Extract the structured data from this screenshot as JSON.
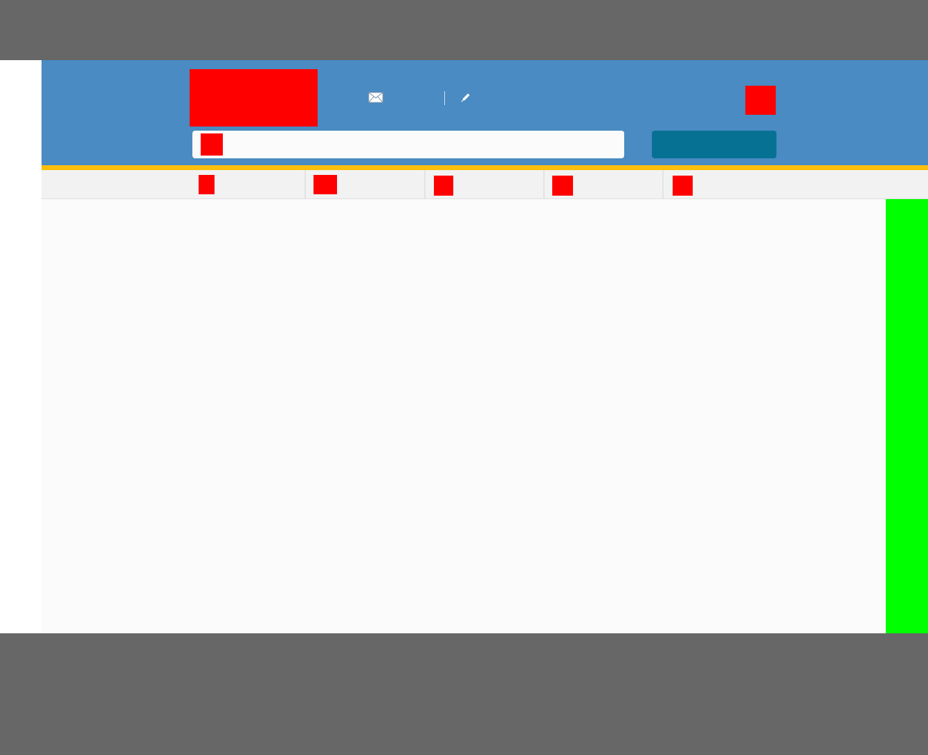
{
  "colors": {
    "backdrop": "#676767",
    "page_background": "#ffffff",
    "header_background": "#498bc2",
    "accent_stripe": "#fbbf0b",
    "nav_background": "#f2f2f2",
    "content_background": "#fbfbfb",
    "search_button": "#077194",
    "side_rail": "#00ff00",
    "placeholder": "#ff0000"
  },
  "header": {
    "logo": "",
    "links": [
      {
        "icon": "envelope-icon",
        "label": ""
      },
      {
        "icon": "pencil-icon",
        "label": ""
      }
    ],
    "cart_label": ""
  },
  "search": {
    "value": "",
    "placeholder": "",
    "button_label": ""
  },
  "nav": {
    "items": [
      {
        "label": ""
      },
      {
        "label": ""
      },
      {
        "label": ""
      },
      {
        "label": ""
      },
      {
        "label": ""
      }
    ]
  },
  "side_rail": {
    "label": ""
  }
}
